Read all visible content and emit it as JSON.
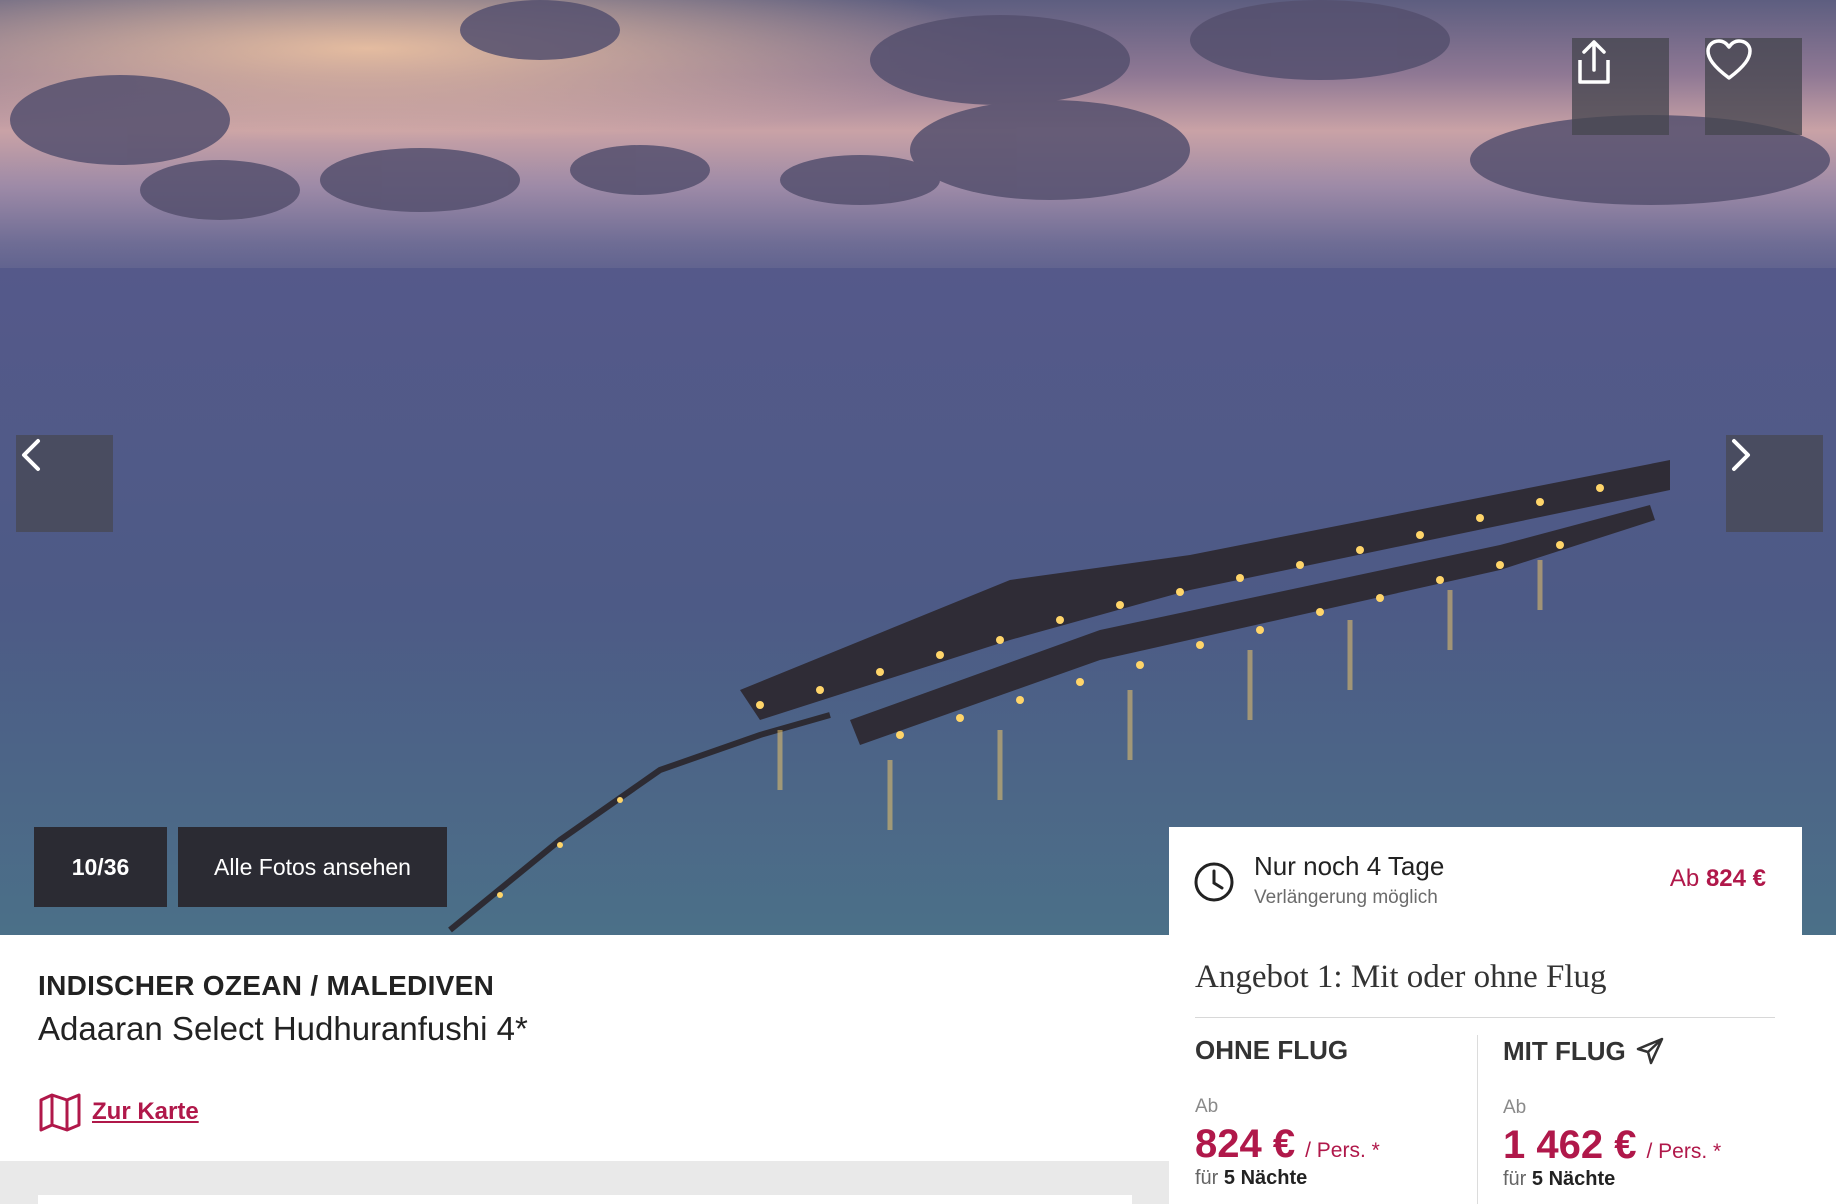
{
  "gallery": {
    "counter": "10/36",
    "all_photos_label": "Alle Fotos ansehen"
  },
  "deal": {
    "title": "Nur noch 4 Tage",
    "subtitle": "Verlängerung möglich",
    "price_prefix": "Ab",
    "price": "824 €"
  },
  "hotel": {
    "region": "INDISCHER OZEAN / MALEDIVEN",
    "name": "Adaaran Select Hudhuranfushi 4*",
    "map_link": "Zur Karte"
  },
  "offer": {
    "title": "Angebot 1: Mit oder ohne Flug",
    "options": [
      {
        "heading": "OHNE FLUG",
        "from": "Ab",
        "price": "824 €",
        "per": "/ Pers. *",
        "for": "für",
        "nights": "5 Nächte"
      },
      {
        "heading": "MIT FLUG",
        "from": "Ab",
        "price": "1 462 €",
        "per": "/ Pers. *",
        "for": "für",
        "nights": "5 Nächte"
      }
    ]
  },
  "icons": [
    "share-icon",
    "heart-icon",
    "chevron-left-icon",
    "chevron-right-icon",
    "clock-icon",
    "map-icon",
    "plane-icon"
  ],
  "colors": {
    "accent": "#b0184a",
    "overlay": "#2b2b33"
  }
}
